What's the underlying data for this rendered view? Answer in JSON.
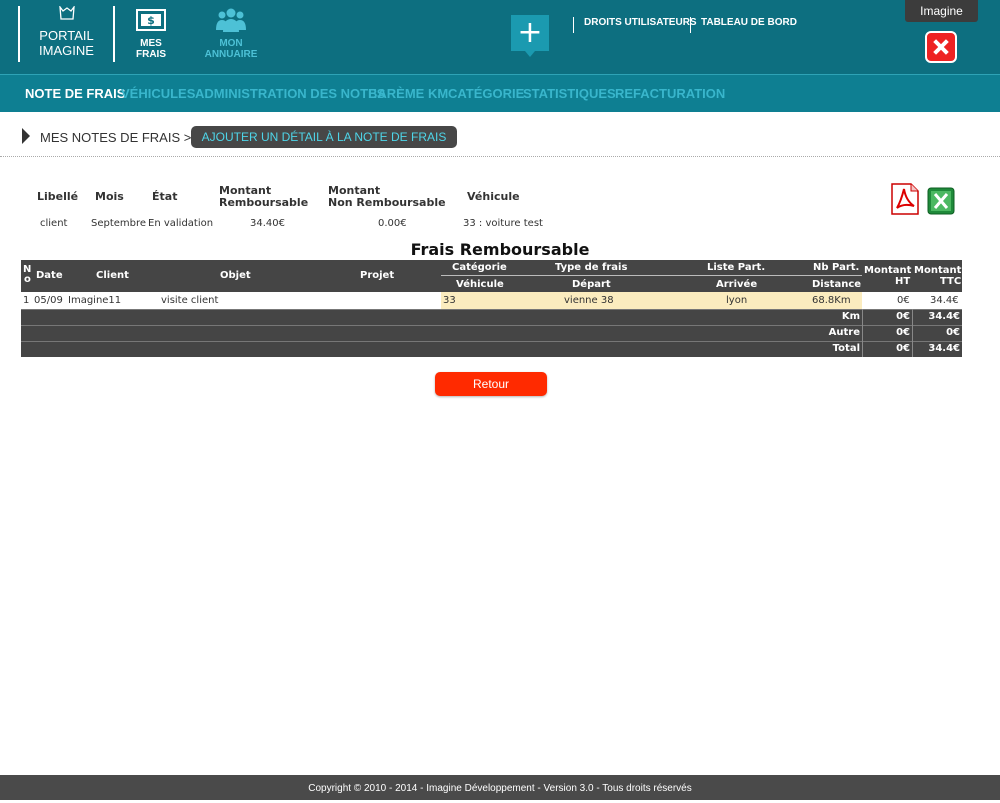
{
  "header": {
    "logo_line1": "PORTAIL",
    "logo_line2": "IMAGINE",
    "nav": [
      {
        "label": "MES FRAIS",
        "color": "#ffffff"
      },
      {
        "label": "MON ANNUAIRE",
        "color": "#4dc1d6"
      }
    ],
    "plus_label": "+",
    "links": [
      "DROITS UTILISATEURS",
      "TABLEAU DE BORD"
    ],
    "user_name": "Imagine"
  },
  "subnav": [
    {
      "label": "NOTE DE FRAIS",
      "active": true
    },
    {
      "label": "VÉHICULES"
    },
    {
      "label": "ADMINISTRATION DES NOTES"
    },
    {
      "label": "BARÈME KM"
    },
    {
      "label": "CATÉGORIE"
    },
    {
      "label": "STATISTIQUES"
    },
    {
      "label": "REFACTURATION"
    }
  ],
  "breadcrumb": {
    "text": "MES NOTES DE FRAIS >",
    "action": "AJOUTER UN DÉTAIL À LA NOTE DE FRAIS"
  },
  "info": {
    "headers": {
      "libelle": "Libellé",
      "mois": "Mois",
      "etat": "État",
      "montant_r1": "Montant",
      "montant_r2": "Remboursable",
      "montant_nr1": "Montant",
      "montant_nr2": "Non Remboursable",
      "vehicule": "Véhicule"
    },
    "values": {
      "libelle": "client",
      "mois": "Septembre",
      "etat": "En validation",
      "montant_r": "34.40€",
      "montant_nr": "0.00€",
      "vehicule": "33 : voiture test"
    }
  },
  "table": {
    "title": "Frais Remboursable",
    "headers": {
      "no_top": "N",
      "no_bottom": "o",
      "date": "Date",
      "client": "Client",
      "objet": "Objet",
      "projet": "Projet",
      "categorie": "Catégorie",
      "type_frais": "Type de frais",
      "liste_part": "Liste Part.",
      "nb_part": "Nb Part.",
      "vehicule": "Véhicule",
      "depart": "Départ",
      "arrivee": "Arrivée",
      "distance": "Distance",
      "montant_ht_1": "Montant",
      "montant_ht_2": "HT",
      "montant_ttc_1": "Montant",
      "montant_ttc_2": "TTC"
    },
    "row": {
      "no": "1",
      "date": "05/09",
      "client": "Imagine11",
      "objet": "visite client",
      "vehicule": "33",
      "depart": "vienne 38",
      "arrivee": "lyon",
      "distance": "68.8Km",
      "ht": "0€",
      "ttc": "34.4€"
    },
    "summary": [
      {
        "label": "Km",
        "ht": "0€",
        "ttc": "34.4€"
      },
      {
        "label": "Autre",
        "ht": "0€",
        "ttc": "0€"
      },
      {
        "label": "Total",
        "ht": "0€",
        "ttc": "34.4€"
      }
    ]
  },
  "retour_label": "Retour",
  "footer": "Copyright © 2010 - 2014 - Imagine Développement - Version 3.0 - Tous droits réservés"
}
